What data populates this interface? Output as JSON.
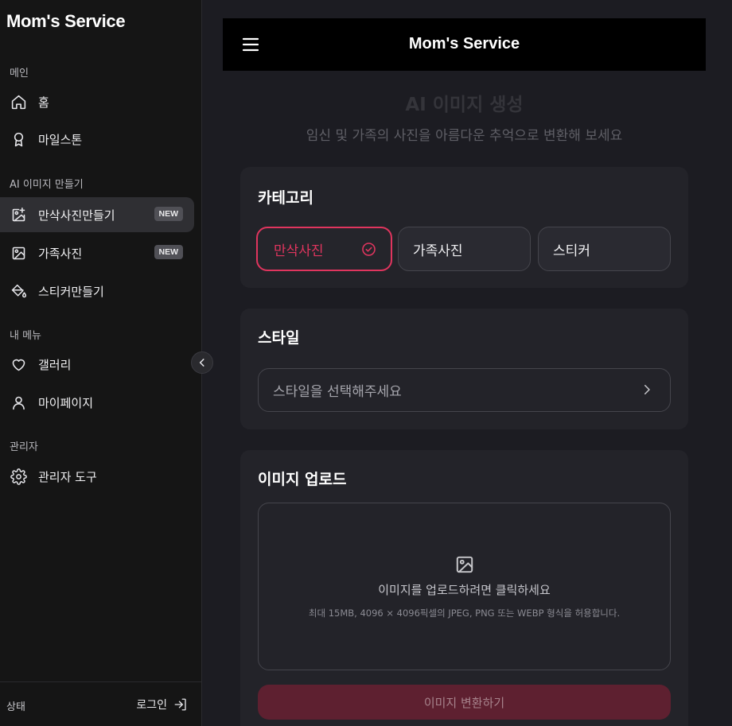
{
  "sidebar": {
    "brand": "Mom's Service",
    "sections": {
      "main": "메인",
      "ai": "AI 이미지 만들기",
      "my": "내 메뉴",
      "admin": "관리자"
    },
    "items": [
      {
        "label": "홈",
        "icon": "home-icon"
      },
      {
        "label": "마일스톤",
        "icon": "award-icon"
      },
      {
        "label": "만삭사진만들기",
        "icon": "image-plus-icon",
        "badge": "NEW",
        "active": true
      },
      {
        "label": "가족사진",
        "icon": "image-icon",
        "badge": "NEW"
      },
      {
        "label": "스티커만들기",
        "icon": "paint-bucket-icon"
      },
      {
        "label": "갤러리",
        "icon": "heart-icon"
      },
      {
        "label": "마이페이지",
        "icon": "user-icon"
      },
      {
        "label": "관리자 도구",
        "icon": "gear-icon"
      }
    ],
    "footer": {
      "status": "상태",
      "login": "로그인"
    }
  },
  "header": {
    "title": "Mom's Service"
  },
  "main": {
    "title": "AI 이미지 생성",
    "subtitle": "임신 및 가족의 사진을 아름다운 추억으로 변환해 보세요",
    "category": {
      "title": "카테고리",
      "options": [
        "만삭사진",
        "가족사진",
        "스티커"
      ],
      "selected": "만삭사진"
    },
    "style": {
      "title": "스타일",
      "placeholder": "스타일을 선택해주세요"
    },
    "upload": {
      "title": "이미지 업로드",
      "prompt": "이미지를 업로드하려면 클릭하세요",
      "hint": "최대 15MB, 4096 × 4096픽셀의 JPEG, PNG 또는 WEBP 형식을 허용합니다.",
      "submit": "이미지 변환하기"
    }
  },
  "colors": {
    "accent": "#e0355e",
    "sidebar_bg": "#151515",
    "page_bg": "#1c1c22",
    "card_bg": "#232329",
    "submit_bg": "#5e2030"
  }
}
